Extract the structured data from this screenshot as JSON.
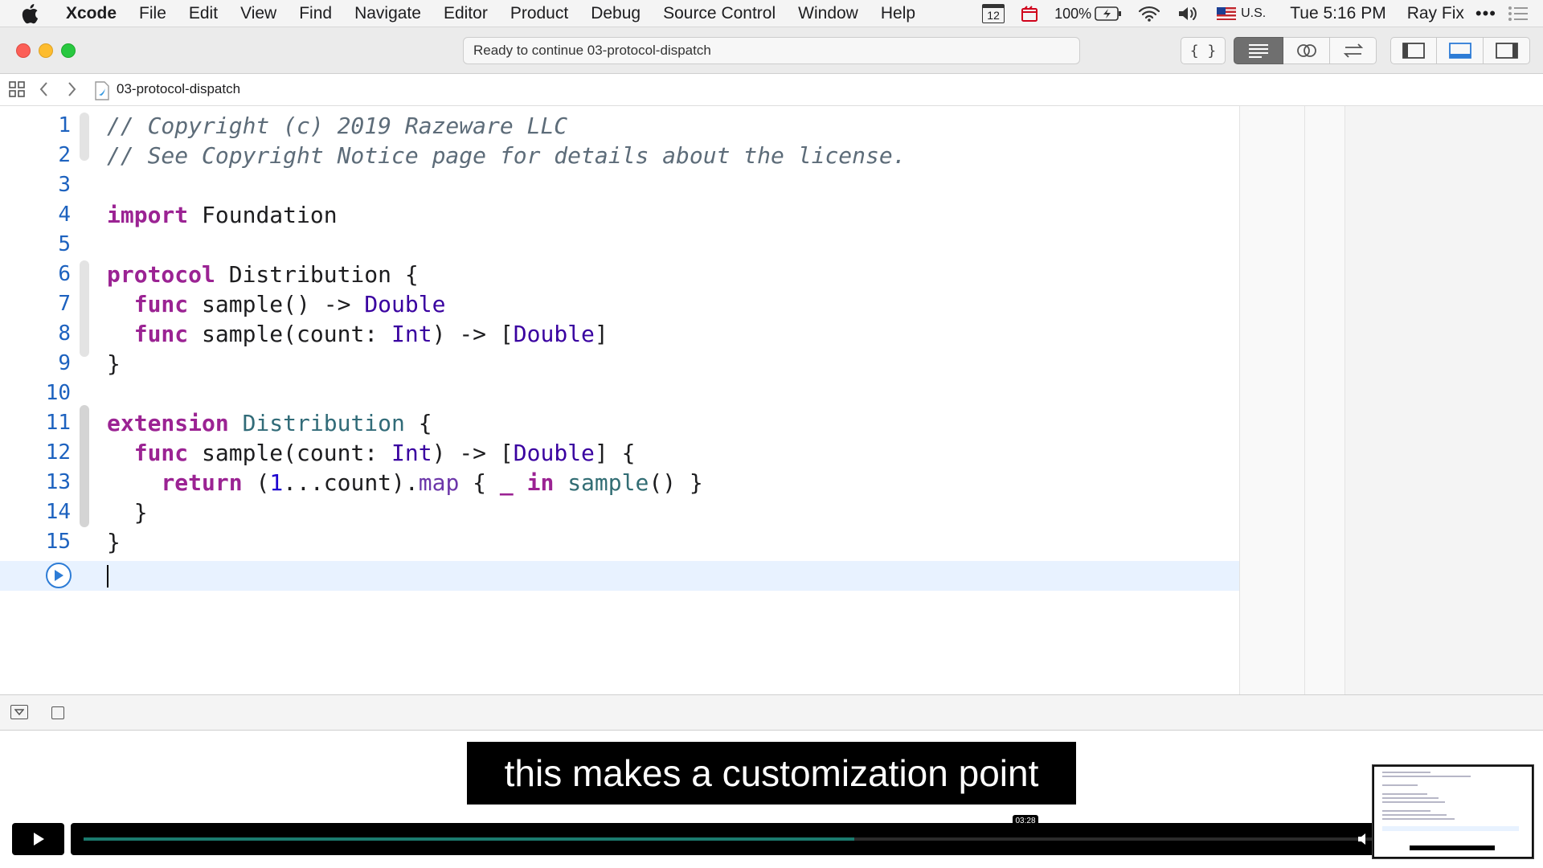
{
  "menubar": {
    "app_name": "Xcode",
    "items": [
      "File",
      "Edit",
      "View",
      "Find",
      "Navigate",
      "Editor",
      "Product",
      "Debug",
      "Source Control",
      "Window",
      "Help"
    ],
    "calendar_day": "12",
    "battery": "100%",
    "input_source": "U.S.",
    "clock": "Tue 5:16 PM",
    "user": "Ray Fix",
    "more": "•••"
  },
  "toolbar": {
    "activity_status": "Ready to continue 03-protocol-dispatch"
  },
  "jumpbar": {
    "file_name": "03-protocol-dispatch"
  },
  "editor": {
    "line_numbers": [
      "1",
      "2",
      "3",
      "4",
      "5",
      "6",
      "7",
      "8",
      "9",
      "10",
      "11",
      "12",
      "13",
      "14",
      "15"
    ],
    "lines": [
      {
        "tokens": [
          {
            "t": "// Copyright (c) 2019 Razeware LLC",
            "c": "com"
          }
        ]
      },
      {
        "tokens": [
          {
            "t": "// See Copyright Notice page for details about the license.",
            "c": "com"
          }
        ]
      },
      {
        "tokens": []
      },
      {
        "tokens": [
          {
            "t": "import",
            "c": "kw"
          },
          {
            "t": " Foundation",
            "c": ""
          }
        ]
      },
      {
        "tokens": []
      },
      {
        "tokens": [
          {
            "t": "protocol",
            "c": "kw"
          },
          {
            "t": " Distribution {",
            "c": ""
          }
        ]
      },
      {
        "tokens": [
          {
            "t": "  ",
            "c": ""
          },
          {
            "t": "func",
            "c": "kw"
          },
          {
            "t": " sample() -> ",
            "c": ""
          },
          {
            "t": "Double",
            "c": "type"
          }
        ]
      },
      {
        "tokens": [
          {
            "t": "  ",
            "c": ""
          },
          {
            "t": "func",
            "c": "kw"
          },
          {
            "t": " sample(count: ",
            "c": ""
          },
          {
            "t": "Int",
            "c": "type"
          },
          {
            "t": ") -> [",
            "c": ""
          },
          {
            "t": "Double",
            "c": "type"
          },
          {
            "t": "]",
            "c": ""
          }
        ]
      },
      {
        "tokens": [
          {
            "t": "}",
            "c": ""
          }
        ]
      },
      {
        "tokens": []
      },
      {
        "tokens": [
          {
            "t": "extension",
            "c": "kw"
          },
          {
            "t": " ",
            "c": ""
          },
          {
            "t": "Distribution",
            "c": "proto"
          },
          {
            "t": " {",
            "c": ""
          }
        ]
      },
      {
        "tokens": [
          {
            "t": "  ",
            "c": ""
          },
          {
            "t": "func",
            "c": "kw"
          },
          {
            "t": " sample(count: ",
            "c": ""
          },
          {
            "t": "Int",
            "c": "type"
          },
          {
            "t": ") -> [",
            "c": ""
          },
          {
            "t": "Double",
            "c": "type"
          },
          {
            "t": "] {",
            "c": ""
          }
        ]
      },
      {
        "tokens": [
          {
            "t": "    ",
            "c": ""
          },
          {
            "t": "return",
            "c": "kw"
          },
          {
            "t": " (",
            "c": ""
          },
          {
            "t": "1",
            "c": "num"
          },
          {
            "t": "...count).",
            "c": ""
          },
          {
            "t": "map",
            "c": "meth"
          },
          {
            "t": " { ",
            "c": ""
          },
          {
            "t": "_",
            "c": "kw"
          },
          {
            "t": " ",
            "c": ""
          },
          {
            "t": "in",
            "c": "kw"
          },
          {
            "t": " ",
            "c": ""
          },
          {
            "t": "sample",
            "c": "call"
          },
          {
            "t": "() }",
            "c": ""
          }
        ]
      },
      {
        "tokens": [
          {
            "t": "  }",
            "c": ""
          }
        ]
      },
      {
        "tokens": [
          {
            "t": "}",
            "c": ""
          }
        ]
      }
    ]
  },
  "video": {
    "subtitle": "this makes a customization point",
    "time_tooltip": "03:28",
    "progress_fraction": 0.564
  },
  "colors": {
    "keyword": "#9b2393",
    "type": "#3900a0",
    "comment": "#5d6c79",
    "line_number": "#1d62bf",
    "current_line": "#e8f2ff"
  }
}
